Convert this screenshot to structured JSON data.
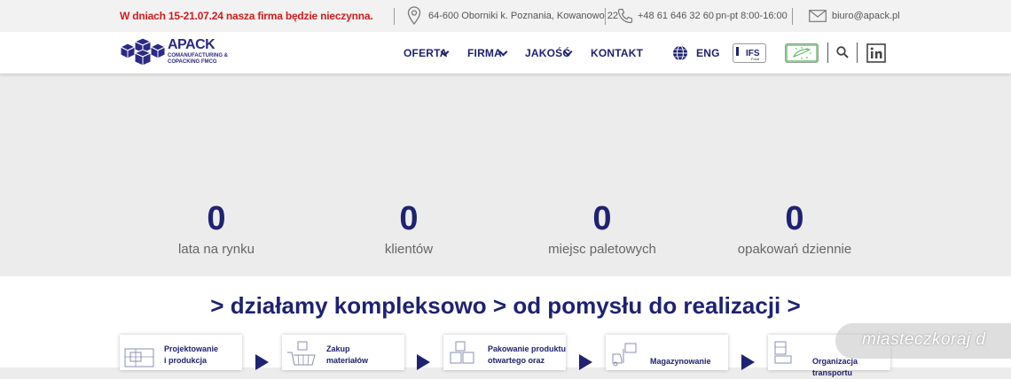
{
  "topbar": {
    "notice": "W dniach 15-21.07.24 nasza firma będzie nieczynna.",
    "address": "64-600 Oborniki k. Poznania, Kowanowo 22",
    "phone": "+48 61 646 32 60",
    "hours": "pn-pt 8:00-16:00",
    "email": "biuro@apack.pl"
  },
  "logo": {
    "name": "APACK",
    "tagline": "COMANUFACTURING & COPACKING FMCG"
  },
  "nav": {
    "items": [
      {
        "label": "OFERTA"
      },
      {
        "label": "FIRMA"
      },
      {
        "label": "JAKOŚĆ"
      },
      {
        "label": "KONTAKT"
      }
    ],
    "lang": "ENG",
    "ifs_label": "IFS"
  },
  "stats": [
    {
      "value": "0",
      "label": "lata na rynku"
    },
    {
      "value": "0",
      "label": "klientów"
    },
    {
      "value": "0",
      "label": "miejsc paletowych"
    },
    {
      "value": "0",
      "label": "opakowań dziennie"
    }
  ],
  "process": {
    "heading": "> działamy kompleksowo > od pomysłu do realizacji >",
    "steps": [
      {
        "line1": "Projektowanie",
        "line2": "i produkcja"
      },
      {
        "line1": "Zakup",
        "line2": "materiałów"
      },
      {
        "line1": "Pakowanie produktu",
        "line2": "otwartego oraz"
      },
      {
        "line1": "Magazynowanie",
        "line2": ""
      },
      {
        "line1": "Organizacja transportu",
        "line2": ""
      }
    ]
  },
  "watermark": "miasteczkoraj d",
  "colors": {
    "brand": "#1f2270",
    "notice": "#d21c1c",
    "eu_green": "#4caf50"
  }
}
